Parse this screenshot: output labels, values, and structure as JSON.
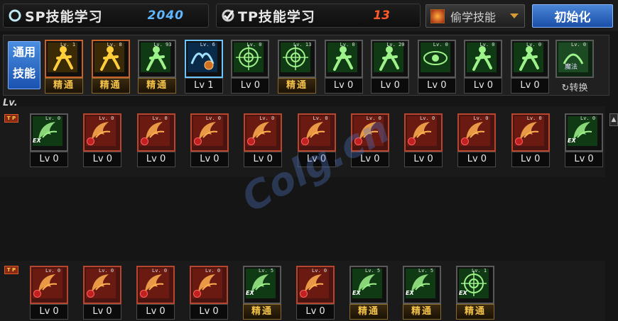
{
  "top": {
    "sp_label": "SP技能学习",
    "sp_value": "2040",
    "tp_label": "TP技能学习",
    "tp_value": "13",
    "steal_label": "偷学技能",
    "reset_label": "初始化"
  },
  "common": {
    "label_line1": "通用",
    "label_line2": "技能",
    "skills": [
      {
        "tag": "Lv. 1",
        "level": "精通",
        "master": true,
        "style": "orange",
        "icon": "kick-figure-icon"
      },
      {
        "tag": "Lv. 8",
        "level": "精通",
        "master": true,
        "style": "orange",
        "icon": "flame-figure-icon"
      },
      {
        "tag": "Lv. 93",
        "level": "精通",
        "master": true,
        "style": "green",
        "icon": "running-figure-icon"
      },
      {
        "tag": "Lv. 6",
        "level": "Lv 1",
        "master": false,
        "style": "blue",
        "icon": "wing-clock-icon"
      },
      {
        "tag": "Lv. 0",
        "level": "Lv 0",
        "master": false,
        "style": "green",
        "icon": "target-crosshair-icon"
      },
      {
        "tag": "Lv. 13",
        "level": "精通",
        "master": true,
        "style": "green",
        "icon": "target-crosshair-icon"
      },
      {
        "tag": "Lv. 0",
        "level": "Lv 0",
        "master": false,
        "style": "green",
        "icon": "slash-figure-icon"
      },
      {
        "tag": "Lv. 20",
        "level": "Lv 0",
        "master": false,
        "style": "green",
        "icon": "slash-figure-icon"
      },
      {
        "tag": "Lv. 0",
        "level": "Lv 0",
        "master": false,
        "style": "green",
        "icon": "eye-icon"
      },
      {
        "tag": "Lv. 0",
        "level": "Lv 0",
        "master": false,
        "style": "green",
        "icon": "armor-figure-icon"
      },
      {
        "tag": "Lv. 0",
        "level": "Lv 0",
        "master": false,
        "style": "green",
        "icon": "leaf-figure-icon"
      }
    ],
    "switch_tag": "Lv. 0",
    "switch_magic": "魔法",
    "switch_label": "转换"
  },
  "lv_header": "Lv.",
  "tp_mark": "T P",
  "tp_row1": [
    {
      "tag": "Lv. 0",
      "level": "Lv 0",
      "style": "green",
      "mark": "EX",
      "icon": "spiral-icon"
    },
    {
      "tag": "Lv. 0",
      "level": "Lv 0",
      "style": "red",
      "mark": "ring",
      "icon": "claw-icon"
    },
    {
      "tag": "Lv. 0",
      "level": "Lv 0",
      "style": "red",
      "mark": "ring",
      "icon": "burst-icon"
    },
    {
      "tag": "Lv. 0",
      "level": "Lv 0",
      "style": "red",
      "mark": "ring",
      "icon": "star-burst-icon"
    },
    {
      "tag": "Lv. 0",
      "level": "Lv 0",
      "style": "red",
      "mark": "ring",
      "icon": "swirl-icon"
    },
    {
      "tag": "Lv. 0",
      "level": "Lv 0",
      "style": "red",
      "mark": "ring",
      "icon": "strike-icon"
    },
    {
      "tag": "Lv. 0",
      "level": "Lv 0",
      "style": "red",
      "mark": "ring",
      "icon": "trident-icon"
    },
    {
      "tag": "Lv. 0",
      "level": "Lv 0",
      "style": "red",
      "mark": "ring",
      "icon": "vortex-icon"
    },
    {
      "tag": "Lv. 0",
      "level": "Lv 0",
      "style": "red",
      "mark": "ring",
      "icon": "pillar-icon"
    },
    {
      "tag": "Lv. 0",
      "level": "Lv 0",
      "style": "red",
      "mark": "ring",
      "icon": "cyclone-icon"
    },
    {
      "tag": "Lv. 0",
      "level": "Lv 0",
      "style": "green",
      "mark": "EX",
      "icon": "spiral-icon"
    }
  ],
  "tp_row2": [
    {
      "tag": "Lv. 0",
      "level": "Lv 0",
      "master": false,
      "style": "red",
      "mark": "ring",
      "icon": "claw-icon"
    },
    {
      "tag": "Lv. 0",
      "level": "Lv 0",
      "master": false,
      "style": "red",
      "mark": "ring",
      "icon": "star-burst-icon"
    },
    {
      "tag": "Lv. 0",
      "level": "Lv 0",
      "master": false,
      "style": "red",
      "mark": "ring",
      "icon": "swirl-icon"
    },
    {
      "tag": "Lv. 0",
      "level": "Lv 0",
      "master": false,
      "style": "red",
      "mark": "ring",
      "icon": "burst-icon"
    },
    {
      "tag": "Lv. 5",
      "level": "精通",
      "master": true,
      "style": "green",
      "mark": "EX",
      "icon": "vortex-icon"
    },
    {
      "tag": "Lv. 0",
      "level": "Lv 0",
      "master": false,
      "style": "red",
      "mark": "ring",
      "icon": "claw-icon"
    },
    {
      "tag": "Lv. 5",
      "level": "精通",
      "master": true,
      "style": "green",
      "mark": "EX",
      "icon": "star-burst-icon"
    },
    {
      "tag": "Lv. 5",
      "level": "精通",
      "master": true,
      "style": "green",
      "mark": "EX",
      "icon": "swirl-icon"
    },
    {
      "tag": "Lv. 1",
      "level": "精通",
      "master": true,
      "style": "green",
      "mark": "EX",
      "icon": "target-crosshair-icon"
    }
  ],
  "watermark": "Colg.cn",
  "colors": {
    "sp": "#5fb8ff",
    "tp": "#ff5a2a",
    "accent": "#1a4fa8",
    "master": "#f2c14a",
    "red_frame": "#b8462e"
  }
}
